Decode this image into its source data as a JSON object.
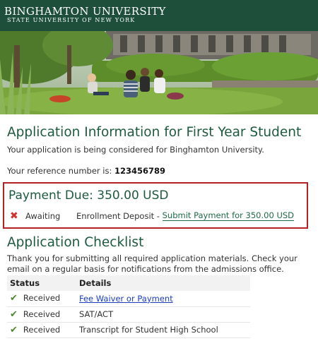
{
  "header": {
    "logo_main": "BINGHAMTON UNIVERSITY",
    "logo_sub": "STATE UNIVERSITY OF NEW YORK"
  },
  "main": {
    "title": "Application Information for First Year Student",
    "intro": "Your application is being considered for Binghamton University.",
    "reference_label": "Your reference number is:",
    "reference_number": "123456789"
  },
  "payment": {
    "title": "Payment Due: 350.00 USD",
    "status": "Awaiting",
    "item": "Enrollment Deposit -",
    "link": "Submit Payment for 350.00 USD",
    "status_icon": "x-icon",
    "border_color": "#b32026"
  },
  "checklist": {
    "title": "Application Checklist",
    "message": "Thank you for submitting all required application materials.  Check your email on a regular basis for notifications from the admissions office.",
    "columns": [
      "Status",
      "Details"
    ],
    "rows": [
      {
        "status": "Received",
        "details": "Fee Waiver or Payment",
        "is_link": true
      },
      {
        "status": "Received",
        "details": "SAT/ACT",
        "is_link": false
      },
      {
        "status": "Received",
        "details": "Transcript for Student High School",
        "is_link": false
      }
    ]
  },
  "colors": {
    "header_bg": "#1d4f3a",
    "heading": "#1d5a3f",
    "link": "#1a3dc4"
  }
}
